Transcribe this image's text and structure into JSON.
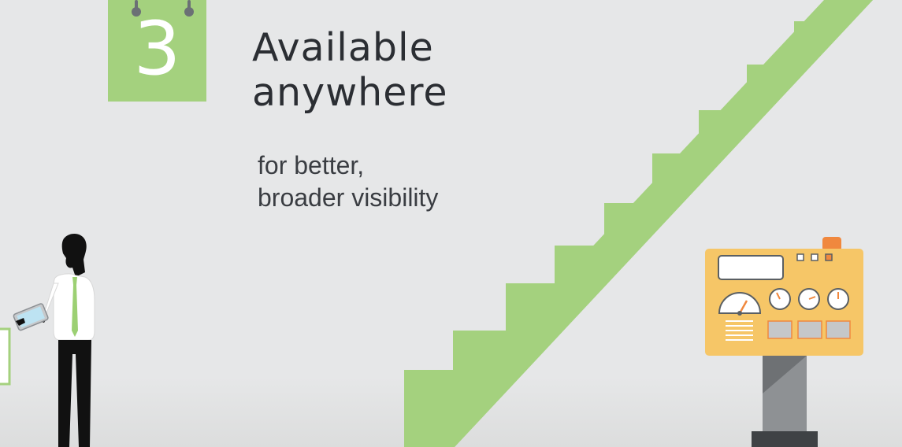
{
  "calendar": {
    "number": "3",
    "color": "#a4d17e"
  },
  "headline": {
    "line1": "Available",
    "line2": "anywhere"
  },
  "subline": {
    "line1": "for better,",
    "line2": "broader visibility"
  },
  "colors": {
    "background": "#e6e7e8",
    "accent_green": "#a4d17e",
    "panel_yellow": "#f6c667",
    "panel_orange": "#f0883e",
    "text_dark": "#2b2e33"
  },
  "illustrations": {
    "person": "businessman-with-tablet-icon",
    "stairs": "staircase-icon",
    "machine": "control-panel-machine-icon"
  }
}
